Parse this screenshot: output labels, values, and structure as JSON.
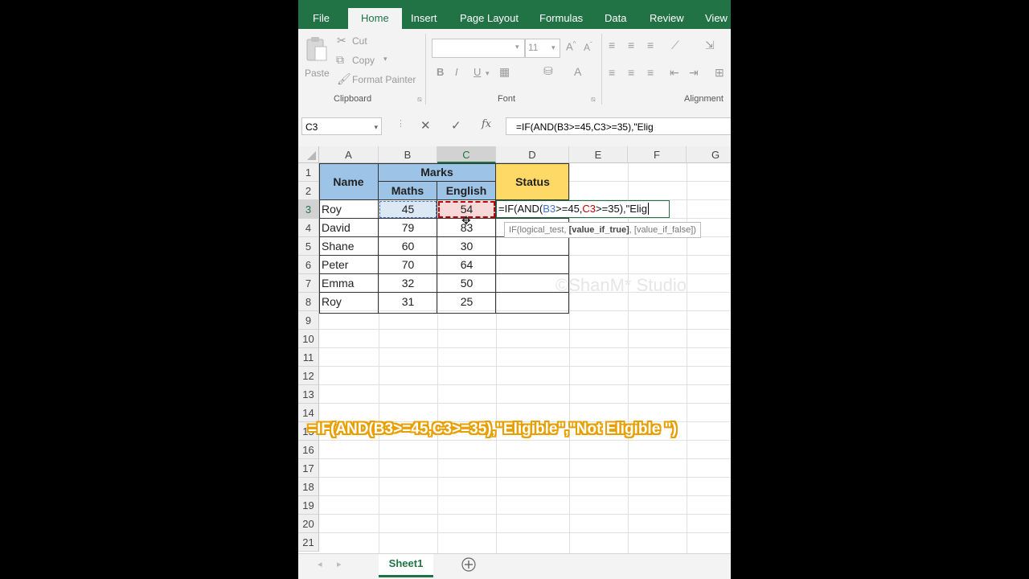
{
  "ribbon_tabs": [
    "File",
    "Home",
    "Insert",
    "Page Layout",
    "Formulas",
    "Data",
    "Review",
    "View"
  ],
  "clipboard": {
    "paste": "Paste",
    "cut": "Cut",
    "copy": "Copy",
    "format_painter": "Format Painter",
    "group": "Clipboard"
  },
  "font": {
    "size": "11",
    "bold": "B",
    "italic": "I",
    "underline": "U",
    "group": "Font"
  },
  "alignment": {
    "group": "Alignment"
  },
  "formula_bar": {
    "name_box": "C3",
    "fx": "fx",
    "formula": "=IF(AND(B3>=45,C3>=35),\"Elig"
  },
  "columns": [
    "A",
    "B",
    "C",
    "D",
    "E",
    "F",
    "G"
  ],
  "rows": [
    "1",
    "2",
    "3",
    "4",
    "5",
    "6",
    "7",
    "8",
    "9",
    "10",
    "11",
    "12",
    "13",
    "14",
    "15",
    "16",
    "17",
    "18",
    "19",
    "20",
    "21"
  ],
  "table": {
    "header_name": "Name",
    "header_marks": "Marks",
    "header_maths": "Maths",
    "header_english": "English",
    "header_status": "Status",
    "rows": [
      {
        "name": "Roy",
        "maths": "45",
        "english": "54"
      },
      {
        "name": "David",
        "maths": "79",
        "english": "83"
      },
      {
        "name": "Shane",
        "maths": "60",
        "english": "30"
      },
      {
        "name": "Peter",
        "maths": "70",
        "english": "64"
      },
      {
        "name": "Emma",
        "maths": "32",
        "english": "50"
      },
      {
        "name": "Roy",
        "maths": "31",
        "english": "25"
      }
    ]
  },
  "editing": {
    "p1": "=IF(AND(",
    "p2": "B3",
    ">p3": "",
    "p3": ">=45,",
    "p4": "C3",
    "p5": ">=35),\"Elig"
  },
  "tooltip": {
    "a": "IF(logical_test, ",
    "b": "[value_if_true]",
    ",c": "",
    "c": ", [value_if_false])"
  },
  "watermark": "©ShanM* Studio",
  "caption": "=IF(AND(B3>=45,C3>=35),\"Eligible\",\"Not Eligible \")",
  "sheet_tab": "Sheet1",
  "colors": {
    "accent": "#217346",
    "header_blue": "#9dc3e6",
    "header_gold": "#ffd966",
    "ref_blue": "#4472c4",
    "ref_red": "#c00000"
  }
}
